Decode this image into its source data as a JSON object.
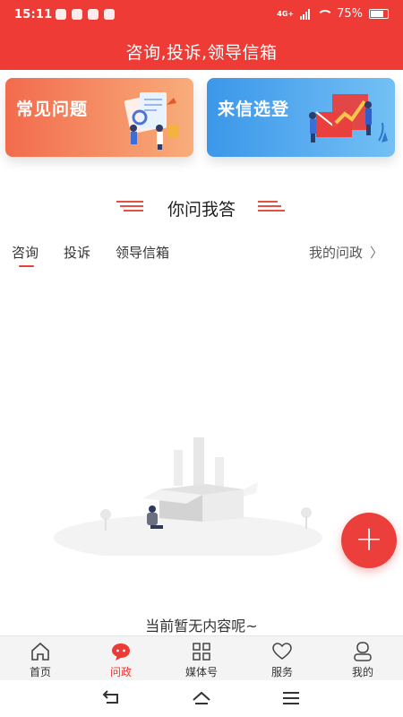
{
  "status": {
    "time": "15:11",
    "network": "4G+",
    "battery": "75%"
  },
  "header": {
    "title": "咨询,投诉,领导信箱"
  },
  "cards": [
    {
      "label": "常见问题",
      "color": "#f26b4d"
    },
    {
      "label": "来信选登",
      "color": "#3b97e9"
    }
  ],
  "section": {
    "title": "你问我答"
  },
  "tabs": [
    {
      "label": "咨询",
      "active": true
    },
    {
      "label": "投诉",
      "active": false
    },
    {
      "label": "领导信箱",
      "active": false
    }
  ],
  "my_link": {
    "label": "我的问政",
    "icon": "chevron-right-icon"
  },
  "empty": {
    "text": "当前暂无内容呢~"
  },
  "fab": {
    "label": "+",
    "icon": "plus-icon"
  },
  "tabbar": [
    {
      "label": "首页",
      "icon": "home-icon"
    },
    {
      "label": "问政",
      "icon": "chat-bubble-icon",
      "active": true
    },
    {
      "label": "媒体号",
      "icon": "grid-icon"
    },
    {
      "label": "服务",
      "icon": "heart-icon"
    },
    {
      "label": "我的",
      "icon": "user-icon"
    }
  ],
  "colors": {
    "brand": "#ee3b36",
    "accent": "#e6433a"
  }
}
